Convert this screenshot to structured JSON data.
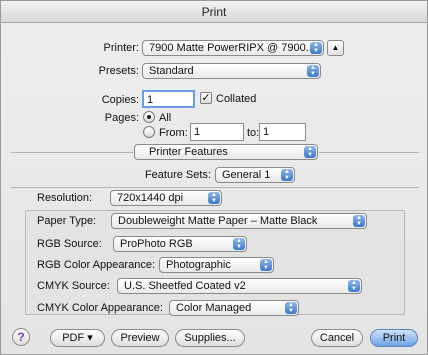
{
  "window": {
    "title": "Print"
  },
  "printer": {
    "label": "Printer:",
    "value": "7900 Matte PowerRIPX @ 7900...",
    "expand_glyph": "▲"
  },
  "presets": {
    "label": "Presets:",
    "value": "Standard"
  },
  "copies": {
    "label": "Copies:",
    "value": "1",
    "collated_label": "Collated",
    "collated": true
  },
  "pages": {
    "label": "Pages:",
    "all_label": "All",
    "from_label": "From:",
    "from_value": "1",
    "to_label": "to:",
    "to_value": "1",
    "selected": "All"
  },
  "section": {
    "value": "Printer Features"
  },
  "feature_sets": {
    "label": "Feature Sets:",
    "value": "General 1"
  },
  "features": {
    "resolution": {
      "label": "Resolution:",
      "value": "720x1440 dpi"
    },
    "paper_type": {
      "label": "Paper Type:",
      "value": "Doubleweight Matte Paper – Matte Black"
    },
    "rgb_source": {
      "label": "RGB Source:",
      "value": "ProPhoto RGB"
    },
    "rgb_color_appearance": {
      "label": "RGB Color Appearance:",
      "value": "Photographic"
    },
    "cmyk_source": {
      "label": "CMYK Source:",
      "value": "U.S. Sheetfed Coated v2"
    },
    "cmyk_color_appearance": {
      "label": "CMYK Color Appearance:",
      "value": "Color Managed"
    }
  },
  "footer": {
    "help": "?",
    "pdf": "PDF ▾",
    "preview": "Preview",
    "supplies": "Supplies...",
    "cancel": "Cancel",
    "print": "Print"
  },
  "colors": {
    "accent": "#3b78cc",
    "help_icon": "#7a3fb8"
  }
}
